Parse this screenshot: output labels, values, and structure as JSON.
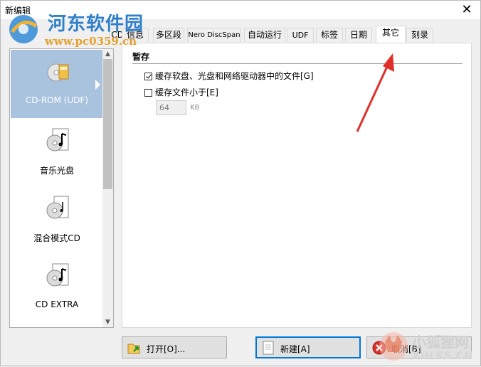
{
  "window": {
    "title": "新编辑",
    "close": "✕"
  },
  "watermark": {
    "site_name": "河东软件园",
    "url": "www.pc0359.cn",
    "fox_name": "小狐狸网",
    "fox_url": "XHLKS.CN"
  },
  "tabs": [
    {
      "label": "CD"
    },
    {
      "label": "信息"
    },
    {
      "label": "多区段"
    },
    {
      "label": "Nero DiscSpan"
    },
    {
      "label": "自动运行"
    },
    {
      "label": "UDF"
    },
    {
      "label": "标签"
    },
    {
      "label": "日期"
    },
    {
      "label": "其它"
    },
    {
      "label": "刻录"
    }
  ],
  "disc_types": [
    {
      "label": "CD-ROM (UDF)",
      "icon": "cd-rom-icon"
    },
    {
      "label": "音乐光盘",
      "icon": "music-disc-icon"
    },
    {
      "label": "混合模式CD",
      "icon": "mixed-mode-icon"
    },
    {
      "label": "CD EXTRA",
      "icon": "cd-extra-icon"
    }
  ],
  "cache": {
    "section_title": "暂存",
    "option1": {
      "label": "缓存软盘、光盘和网络驱动器中的文件[G]",
      "checked": true
    },
    "option2": {
      "label": "缓存文件小于[E]",
      "checked": false
    },
    "size_value": "64",
    "size_unit": "KB"
  },
  "buttons": {
    "open": "打开[O]...",
    "new": "新建[A]",
    "cancel": "取消[B]"
  },
  "colors": {
    "accent": "#0078d7",
    "selection": "#a9c3df",
    "arrow": "#e0302a"
  }
}
